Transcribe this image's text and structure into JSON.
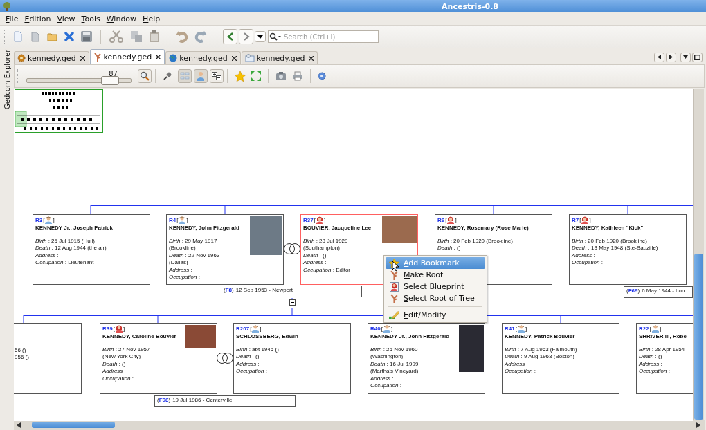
{
  "window": {
    "title": "Ancestris-0.8"
  },
  "menu": [
    "File",
    "Edition",
    "View",
    "Tools",
    "Window",
    "Help"
  ],
  "search": {
    "placeholder": "Search (Ctrl+I)"
  },
  "side_tab": "Gedcom Explorer",
  "tabs": [
    {
      "label": "kennedy.ged",
      "kind": "gear",
      "selected": false
    },
    {
      "label": "kennedy.ged",
      "kind": "tree",
      "selected": true
    },
    {
      "label": "kennedy.ged",
      "kind": "globe",
      "selected": false
    },
    {
      "label": "kennedy.ged",
      "kind": "document",
      "selected": false
    }
  ],
  "zoom": {
    "value": "87",
    "level": 0.8
  },
  "tree": {
    "rows": [
      {
        "cards": [
          {
            "kind": "person",
            "ref": "R3",
            "open": "[",
            "close": "]",
            "female": false,
            "name": "KENNEDY Jr., Joseph Patrick",
            "photo": false,
            "selected": false,
            "lines": [
              "*Birth* : 25 Jul 1915  (Hull)",
              "*Death* : 12 Aug 1944  (the air)",
              "*Address* :",
              "*Occupation* : Lieutenant"
            ]
          },
          {
            "kind": "person",
            "ref": "R4",
            "open": "[",
            "close": "]",
            "female": false,
            "name": "KENNEDY, John Fitzgerald",
            "photo": true,
            "selected": false,
            "lines": [
              "*Birth* : 29 May 1917",
              "(Brookline)",
              "*Death* : 22 Nov 1963",
              "(Dallas)",
              "*Address* :",
              "*Occupation* :"
            ]
          },
          {
            "kind": "person",
            "ref": "R37",
            "open": "[",
            "close": "]",
            "female": true,
            "name": "BOUVIER, Jacqueline Lee",
            "photo": true,
            "selected": true,
            "lines": [
              "*Birth* : 28 Jul 1929",
              "(Southampton)",
              "*Death* :  ()",
              "*Address* :",
              "*Occupation* : Editor"
            ]
          },
          {
            "kind": "person",
            "ref": "R6",
            "open": "[",
            "close": "]",
            "female": true,
            "name": "KENNEDY, Rosemary (Rose Marie)",
            "photo": false,
            "selected": false,
            "lines": [
              "*Birth* : 20 Feb 1920  (Brookline)",
              "*Death* :  ()"
            ]
          },
          {
            "kind": "person",
            "ref": "R7",
            "open": "[",
            "close": "]",
            "female": true,
            "name": "KENNEDY, Kathleen \"Kick\"",
            "photo": false,
            "selected": false,
            "lines": [
              "*Birth* : 20 Feb 1920  (Brookline)",
              "*Death* : 13 May 1948  (Ste-Bauzille)",
              "*Address* :",
              "*Occupation* :"
            ]
          }
        ]
      },
      {
        "cards": [
          {
            "kind": "clipped",
            "lines": [
              "56  ()",
              "956  ()"
            ]
          },
          {
            "kind": "person",
            "ref": "R39",
            "open": "[",
            "close": "]",
            "female": true,
            "name": "KENNEDY, Caroline Bouvier",
            "photo": true,
            "selected": false,
            "lines": [
              "*Birth* : 27 Nov 1957",
              "(New York City)",
              "*Death* :  ()",
              "*Address* :",
              "*Occupation* :"
            ]
          },
          {
            "kind": "person",
            "ref": "R207",
            "open": "[",
            "close": "]",
            "female": false,
            "name": "SCHLOSSBERG, Edwin",
            "photo": false,
            "selected": false,
            "lines": [
              "*Birth* : abt 1945  ()",
              "*Death* :  ()",
              "*Address* :",
              "*Occupation* :"
            ]
          },
          {
            "kind": "person",
            "ref": "R40",
            "open": "[",
            "close": "]",
            "female": false,
            "name": "KENNEDY Jr., John Fitzgerald",
            "photo": true,
            "selected": false,
            "lines": [
              "*Birth* : 25 Nov 1960",
              "(Washington)",
              "*Death* : 16 Jul 1999",
              "(Martha's Vineyard)",
              "*Address* :",
              "*Occupation* :"
            ]
          },
          {
            "kind": "person",
            "ref": "R41",
            "open": "[",
            "close": "]",
            "female": false,
            "name": "KENNEDY, Patrick Bouvier",
            "photo": false,
            "selected": false,
            "lines": [
              "*Birth* : 7 Aug 1963  (Falmouth)",
              "*Death* : 9 Aug 1963  (Boston)",
              "*Address* :",
              "*Occupation* :"
            ]
          },
          {
            "kind": "person",
            "ref": "R22",
            "open": "[",
            "close": "]",
            "female": false,
            "name": "SHRIVER III, Robe",
            "photo": false,
            "selected": false,
            "lines": [
              "*Birth* : 28 Apr 1954",
              "*Death* :  ()",
              "*Address* :",
              "*Occupation* :"
            ]
          }
        ]
      }
    ],
    "families": [
      {
        "open": "(",
        "ref": "F8",
        "close": ")",
        "text": "12 Sep 1953 - Newport"
      },
      {
        "open": "(",
        "ref": "F68",
        "close": ")",
        "text": "19 Jul 1986 - Centerville"
      },
      {
        "open": "(",
        "ref": "F69",
        "close": ")",
        "text": "6 May 1944 - Lon"
      }
    ]
  },
  "context_menu": [
    {
      "kind": "bookmark",
      "label": "Add Bookmark",
      "selected": true
    },
    {
      "kind": "root",
      "label": "Make Root",
      "selected": false
    },
    {
      "kind": "blueprint",
      "label": "Select Blueprint",
      "selected": false
    },
    {
      "kind": "root",
      "label": "Select Root of Tree",
      "selected": false
    },
    {
      "kind": "separator"
    },
    {
      "kind": "edit",
      "label": "Edit/Modify",
      "selected": false
    }
  ]
}
